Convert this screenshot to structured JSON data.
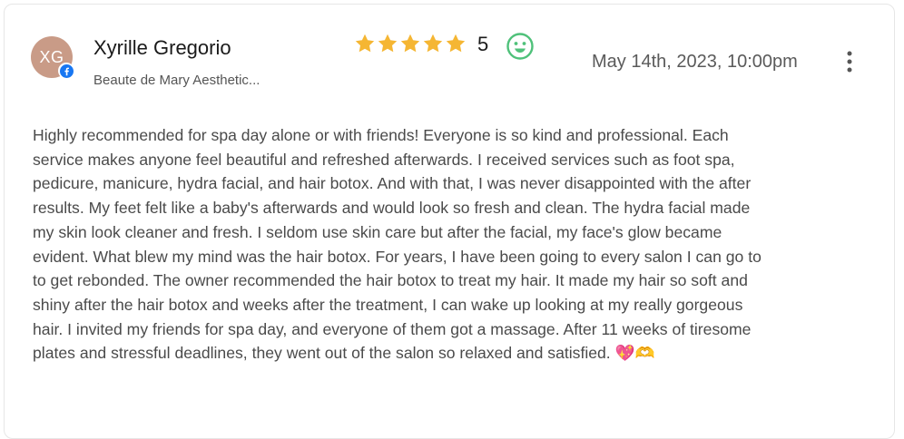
{
  "review": {
    "avatar_initials": "XG",
    "reviewer_name": "Xyrille Gregorio",
    "source_name": "Beaute de Mary Aesthetic...",
    "source_platform_icon": "facebook-icon",
    "rating_value": "5",
    "stars_total": 5,
    "stars_filled": 5,
    "sentiment_icon": "smiley-icon",
    "date": "May 14th, 2023, 10:00pm",
    "more_icon": "more-vertical-icon",
    "text": "Highly recommended for spa day alone or with friends! Everyone is so kind and professional. Each service makes anyone feel beautiful and refreshed afterwards. I received services such as foot spa, pedicure, manicure, hydra facial, and hair botox. And with that, I was never disappointed with the after results. My feet felt like a baby's afterwards and would look so fresh and clean. The hydra facial made my skin look cleaner and fresh. I seldom use skin care but after the facial, my face's glow became evident. What blew my mind was the hair botox. For years, I have been going to every salon I can go to to get rebonded. The owner recommended the hair botox to treat my hair. It made my hair so soft and shiny after the hair botox and weeks after the treatment, I can wake up looking at my really gorgeous hair. I invited my friends for spa day, and everyone of them got a massage. After 11 weeks of tiresome plates and stressful deadlines, they went out of the salon so relaxed and satisfied. 💖🫶"
  },
  "colors": {
    "avatar_bg": "#c99b87",
    "star": "#f5b633",
    "smiley": "#4fc17a",
    "facebook": "#1877f2"
  }
}
